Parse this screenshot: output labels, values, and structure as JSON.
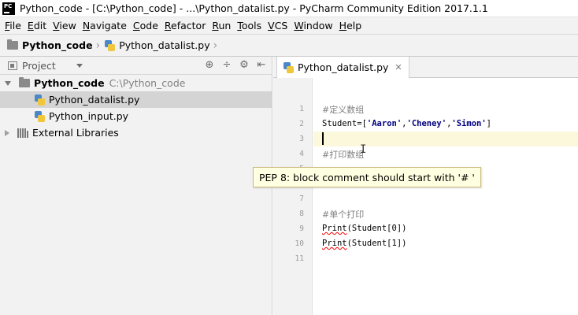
{
  "window": {
    "title": "Python_code - [C:\\Python_code] - ...\\Python_datalist.py - PyCharm Community Edition 2017.1.1",
    "app_icon_label": "PC"
  },
  "menu": {
    "items": [
      {
        "label": "File",
        "mnemonic": "F",
        "rest": "ile"
      },
      {
        "label": "Edit",
        "mnemonic": "E",
        "rest": "dit"
      },
      {
        "label": "View",
        "mnemonic": "V",
        "rest": "iew"
      },
      {
        "label": "Navigate",
        "mnemonic": "N",
        "rest": "avigate"
      },
      {
        "label": "Code",
        "mnemonic": "C",
        "rest": "ode"
      },
      {
        "label": "Refactor",
        "mnemonic": "R",
        "rest": "efactor"
      },
      {
        "label": "Run",
        "mnemonic": "R",
        "rest": "un"
      },
      {
        "label": "Tools",
        "mnemonic": "T",
        "rest": "ools"
      },
      {
        "label": "VCS",
        "mnemonic": "V",
        "rest": "CS"
      },
      {
        "label": "Window",
        "mnemonic": "W",
        "rest": "indow"
      },
      {
        "label": "Help",
        "mnemonic": "H",
        "rest": "elp"
      }
    ]
  },
  "navbar": {
    "project": "Python_code",
    "file": "Python_datalist.py"
  },
  "project_panel": {
    "title": "Project",
    "tree": {
      "root": {
        "name": "Python_code",
        "path": "C:\\Python_code"
      },
      "files": [
        "Python_datalist.py",
        "Python_input.py"
      ],
      "external": "External Libraries"
    },
    "selected_file": "Python_datalist.py"
  },
  "editor": {
    "tab_label": "Python_datalist.py",
    "line_numbers": [
      "1",
      "2",
      "3",
      "4",
      "5",
      "6",
      "7",
      "8",
      "9",
      "10",
      "11"
    ],
    "lines": {
      "l1": "#定义数组",
      "l2_prefix": "Student=[",
      "l2_items": [
        "'Aaron'",
        "'Cheney'",
        "'Simon'"
      ],
      "l2_suffix": "]",
      "l4": "#打印数组",
      "l8": "#单个打印",
      "l9_func": "Print",
      "l9_args": "(Student[0])",
      "l10_func": "Print",
      "l10_args": "(Student[1])"
    },
    "current_line": 3
  },
  "tooltip": {
    "text": "PEP 8: block comment should start with '# '"
  }
}
